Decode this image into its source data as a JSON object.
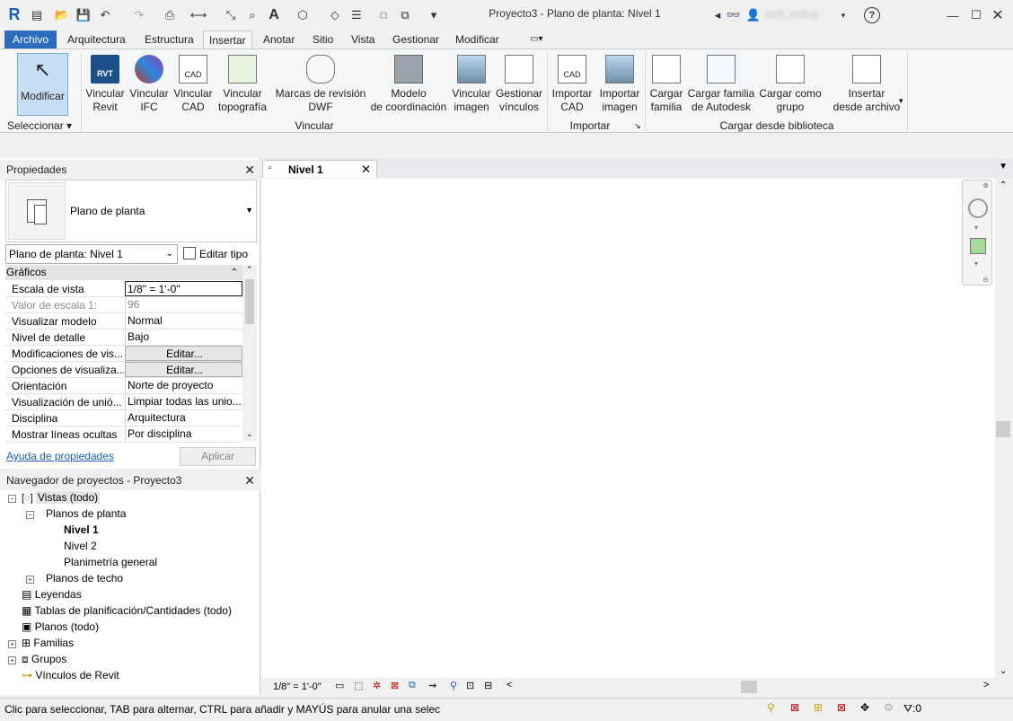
{
  "title": {
    "text": "Proyecto3 - Plano de planta: Nivel 1",
    "user": "revit_lookup",
    "help": "?"
  },
  "ribbon_tabs": [
    "Archivo",
    "Arquitectura",
    "Estructura",
    "Insertar",
    "Anotar",
    "Sitio",
    "Vista",
    "Gestionar",
    "Modificar"
  ],
  "ribbon": {
    "modificar": "Modificar",
    "seleccionar": "Seleccionar",
    "buttons": [
      {
        "l1": "Vincular",
        "l2": "Revit"
      },
      {
        "l1": "Vincular",
        "l2": "IFC"
      },
      {
        "l1": "Vincular",
        "l2": "CAD"
      },
      {
        "l1": "Vincular",
        "l2": "topografía"
      },
      {
        "l1": "Marcas de revisión",
        "l2": "DWF"
      },
      {
        "l1": "Modelo",
        "l2": "de coordinación"
      },
      {
        "l1": "Vincular",
        "l2": "imagen"
      },
      {
        "l1": "Gestionar",
        "l2": "vínculos"
      },
      {
        "l1": "Importar",
        "l2": "CAD"
      },
      {
        "l1": "Importar",
        "l2": "imagen"
      },
      {
        "l1": "Cargar",
        "l2": "familia"
      },
      {
        "l1": "Cargar familia",
        "l2": "de Autodesk"
      },
      {
        "l1": "Cargar como",
        "l2": "grupo"
      },
      {
        "l1": "Insertar",
        "l2": "desde archivo"
      }
    ],
    "panels": {
      "vincular": "Vincular",
      "importar": "Importar",
      "cargar": "Cargar desde biblioteca"
    }
  },
  "properties": {
    "header": "Propiedades",
    "type_name": "Plano de planta",
    "instance": "Plano de planta: Nivel 1",
    "edit_type": "Editar tipo",
    "group": "Gráficos",
    "rows": [
      {
        "k": "Escala de vista",
        "v": "1/8\" = 1'-0\""
      },
      {
        "k": "Valor de escala    1:",
        "v": "96"
      },
      {
        "k": "Visualizar modelo",
        "v": "Normal"
      },
      {
        "k": "Nivel de detalle",
        "v": "Bajo"
      },
      {
        "k": "Modificaciones de vis...",
        "v": "Editar..."
      },
      {
        "k": "Opciones de visualiza...",
        "v": "Editar..."
      },
      {
        "k": "Orientación",
        "v": "Norte de proyecto"
      },
      {
        "k": "Visualización de unió...",
        "v": "Limpiar todas las unio..."
      },
      {
        "k": "Disciplina",
        "v": "Arquitectura"
      },
      {
        "k": "Mostrar líneas ocultas",
        "v": "Por disciplina"
      }
    ],
    "help": "Ayuda de propiedades",
    "apply": "Aplicar"
  },
  "browser": {
    "header": "Navegador de proyectos - Proyecto3",
    "nodes": [
      "Vistas (todo)",
      "Planos de planta",
      "Nivel 1",
      "Nivel 2",
      "Planimetría general",
      "Planos de techo",
      "Leyendas",
      "Tablas de planificación/Cantidades (todo)",
      "Planos (todo)",
      "Familias",
      "Grupos",
      "Vínculos de Revit"
    ]
  },
  "view": {
    "tab": "Nivel 1",
    "scale": "1/8\" = 1'-0\""
  },
  "status": {
    "text": "Clic para seleccionar, TAB para alternar, CTRL para añadir y MAYÚS para anular una selec",
    "filter_count": ":0"
  }
}
